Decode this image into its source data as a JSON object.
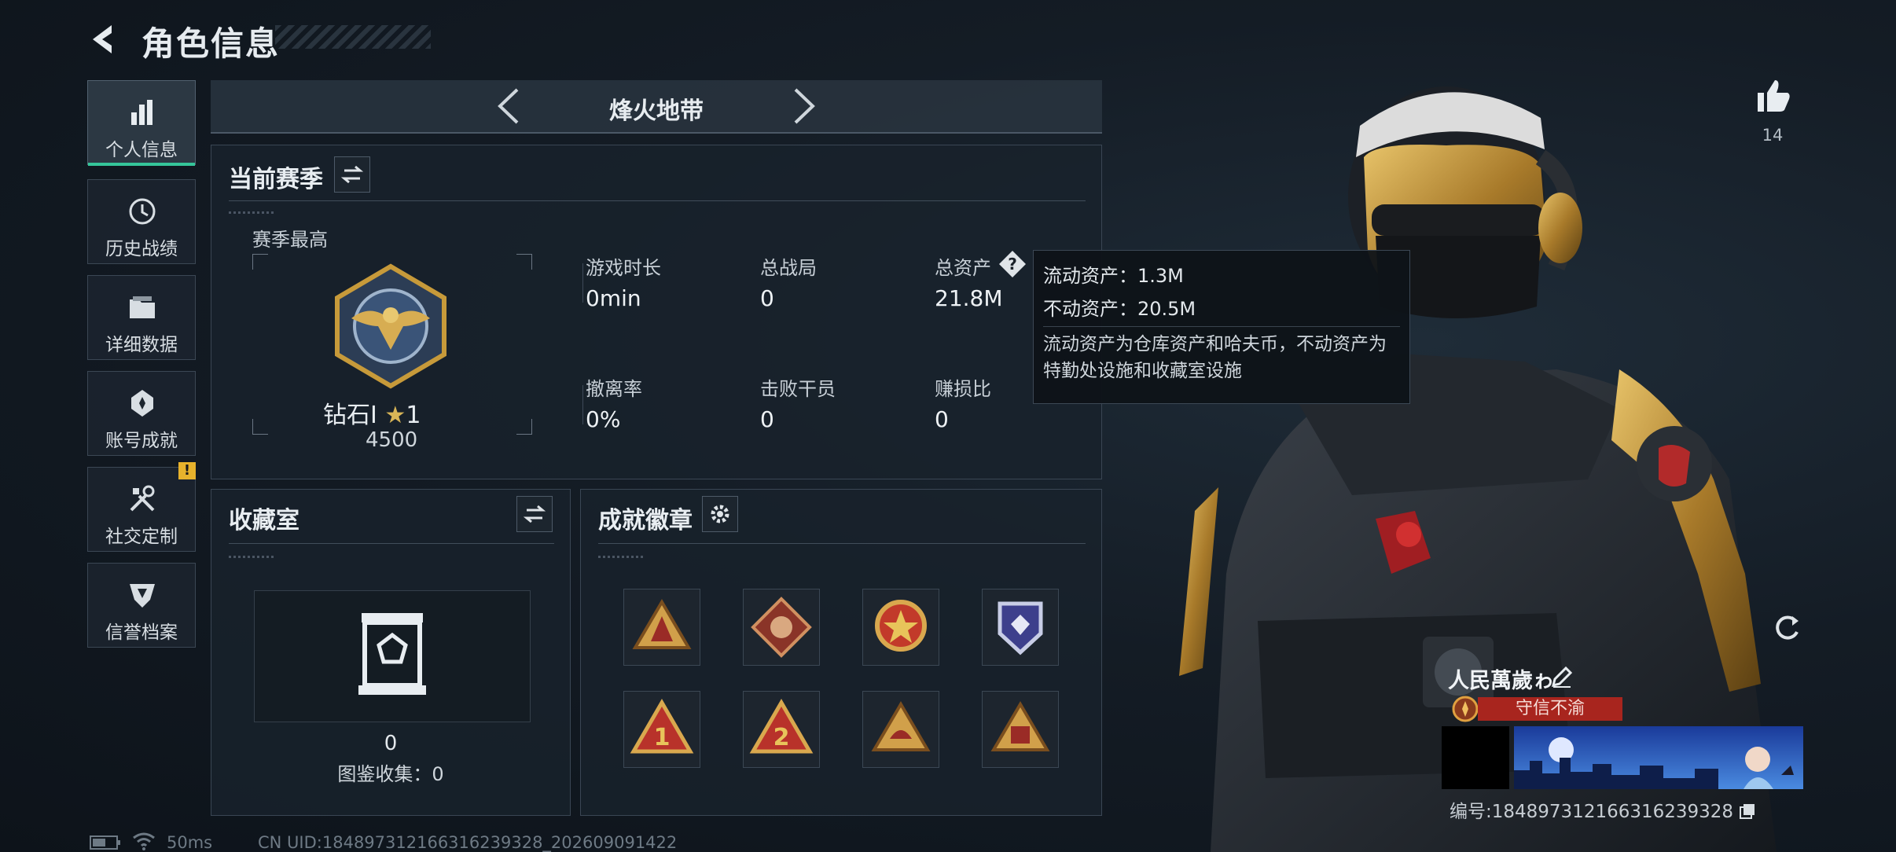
{
  "header": {
    "title": "角色信息"
  },
  "sidebar": {
    "items": [
      {
        "label": "个人信息",
        "icon": "bar-chart-icon",
        "active": true
      },
      {
        "label": "历史战绩",
        "icon": "history-icon"
      },
      {
        "label": "详细数据",
        "icon": "folder-icon"
      },
      {
        "label": "账号成就",
        "icon": "achievement-icon"
      },
      {
        "label": "社交定制",
        "icon": "tools-icon",
        "badge": "!"
      },
      {
        "label": "信誉档案",
        "icon": "shield-icon"
      }
    ]
  },
  "mode_bar": {
    "label": "烽火地带"
  },
  "season": {
    "title": "当前赛季",
    "best_label": "赛季最高",
    "rank_name": "钻石Ⅰ",
    "rank_star_count": "1",
    "rank_points": "4500",
    "stats": {
      "play_time": {
        "label": "游戏时长",
        "value": "0min"
      },
      "total_matches": {
        "label": "总战局",
        "value": "0"
      },
      "total_assets": {
        "label": "总资产",
        "value": "21.8M"
      },
      "extract_rate": {
        "label": "撤离率",
        "value": "0%"
      },
      "operators_defeated": {
        "label": "击败干员",
        "value": "0"
      },
      "profit_ratio": {
        "label": "赚损比",
        "value": "0"
      }
    }
  },
  "tooltip": {
    "liquid": "流动资产：1.3M",
    "fixed": "不动资产：20.5M",
    "body": "流动资产为仓库资产和哈夫币，不动资产为特勤处设施和收藏室设施"
  },
  "collection": {
    "title": "收藏室",
    "count": "0",
    "catalog": "图鉴收集：0"
  },
  "badges": {
    "title": "成就徽章"
  },
  "like": {
    "count": "14"
  },
  "player": {
    "name": "人民萬歲ゎ",
    "reputation": "守信不渝",
    "uid": "编号:1848973121663162393​28"
  },
  "status": {
    "ping": "50ms",
    "uid": "CN UID:18489731216631623932​8_202609091422"
  },
  "colors": {
    "accent": "#35c59a",
    "warning": "#e7b22c",
    "reputation": "#a8251e",
    "gold": "#c79a3a"
  }
}
